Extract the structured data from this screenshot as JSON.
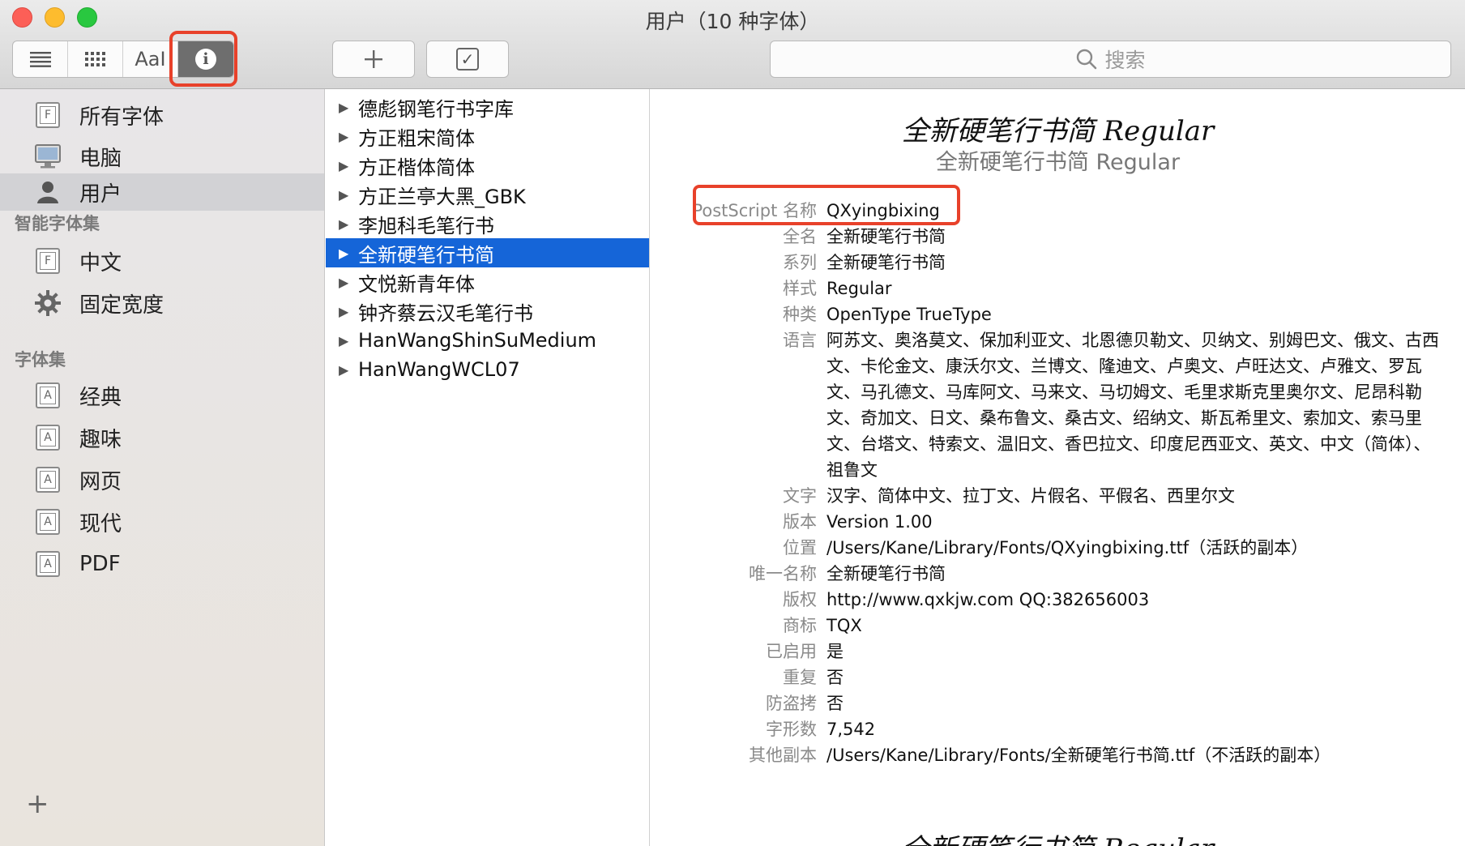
{
  "window": {
    "title": "用户（10 种字体）"
  },
  "toolbar": {
    "view_aa_label": "AaI",
    "add_label": "+",
    "check_label": "✓",
    "search_placeholder": "搜索"
  },
  "sidebar": {
    "top_items": [
      {
        "label": "所有字体",
        "icon": "all-fonts-icon"
      },
      {
        "label": "电脑",
        "icon": "computer-icon"
      },
      {
        "label": "用户",
        "icon": "user-icon",
        "selected": true
      }
    ],
    "smart_header": "智能字体集",
    "smart_items": [
      {
        "label": "中文",
        "icon": "smart-collection-icon"
      },
      {
        "label": "固定宽度",
        "icon": "gear-icon"
      }
    ],
    "collections_header": "字体集",
    "collection_items": [
      {
        "label": "经典"
      },
      {
        "label": "趣味"
      },
      {
        "label": "网页"
      },
      {
        "label": "现代"
      },
      {
        "label": "PDF"
      }
    ],
    "add_label": "+"
  },
  "fontlist": {
    "items": [
      {
        "label": "德彪钢笔行书字库"
      },
      {
        "label": "方正粗宋简体"
      },
      {
        "label": "方正楷体简体"
      },
      {
        "label": "方正兰亭大黑_GBK"
      },
      {
        "label": "李旭科毛笔行书"
      },
      {
        "label": "全新硬笔行书简",
        "selected": true
      },
      {
        "label": "文悦新青年体"
      },
      {
        "label": "钟齐蔡云汉毛笔行书"
      },
      {
        "label": "HanWangShinSuMedium"
      },
      {
        "label": "HanWangWCL07"
      }
    ]
  },
  "info": {
    "preview_script": "全新硬笔行书简 Regular",
    "preview_plain": "全新硬笔行书简 Regular",
    "properties": [
      {
        "key": "PostScript 名称",
        "value": "QXyingbixing"
      },
      {
        "key": "全名",
        "value": "全新硬笔行书简"
      },
      {
        "key": "系列",
        "value": "全新硬笔行书简"
      },
      {
        "key": "样式",
        "value": "Regular"
      },
      {
        "key": "种类",
        "value": "OpenType TrueType"
      },
      {
        "key": "语言",
        "value": "阿苏文、奥洛莫文、保加利亚文、北恩德贝勒文、贝纳文、别姆巴文、俄文、古西文、卡伦金文、康沃尔文、兰博文、隆迪文、卢奥文、卢旺达文、卢雅文、罗瓦文、马孔德文、马库阿文、马来文、马切姆文、毛里求斯克里奥尔文、尼昂科勒文、奇加文、日文、桑布鲁文、桑古文、绍纳文、斯瓦希里文、索加文、索马里文、台塔文、特索文、温旧文、香巴拉文、印度尼西亚文、英文、中文（简体）、祖鲁文"
      },
      {
        "key": "文字",
        "value": "汉字、简体中文、拉丁文、片假名、平假名、西里尔文"
      },
      {
        "key": "版本",
        "value": "Version 1.00"
      },
      {
        "key": "位置",
        "value": "/Users/Kane/Library/Fonts/QXyingbixing.ttf（活跃的副本）"
      },
      {
        "key": "唯一名称",
        "value": "全新硬笔行书简"
      },
      {
        "key": "版权",
        "value": "http://www.qxkjw.com  QQ:382656003"
      },
      {
        "key": "商标",
        "value": "TQX"
      },
      {
        "key": "已启用",
        "value": "是"
      },
      {
        "key": "重复",
        "value": "否"
      },
      {
        "key": "防盗拷",
        "value": "否"
      },
      {
        "key": "字形数",
        "value": "7,542"
      },
      {
        "key": "其他副本",
        "value": "/Users/Kane/Library/Fonts/全新硬笔行书简.ttf（不活跃的副本）"
      }
    ],
    "preview_bottom": "全新硬笔行书简 Regular"
  },
  "colors": {
    "selection_blue": "#1565d8",
    "highlight_red": "#e8412a"
  }
}
